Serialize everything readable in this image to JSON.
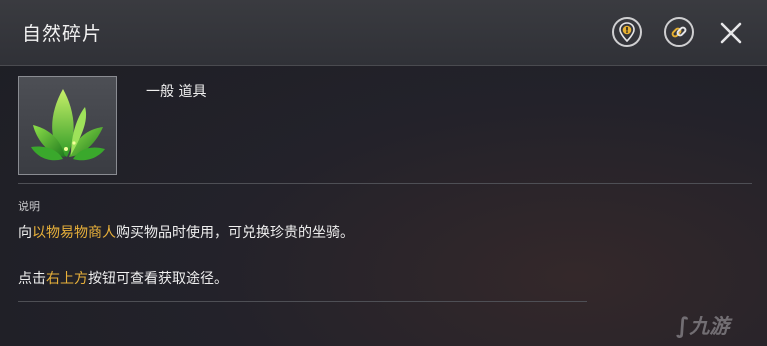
{
  "window": {
    "title": "自然碎片",
    "buttons": {
      "locate_icon": "map-pin-exclamation-icon",
      "link_icon": "chain-link-icon",
      "close_icon": "close-icon"
    }
  },
  "item": {
    "icon": "green-leaf-plant-icon",
    "type_label": "一般 道具"
  },
  "description": {
    "label": "说明",
    "line1": {
      "pre": "向",
      "highlight": "以物易物商人",
      "post": "购买物品时使用，可兑换珍贵的坐骑。"
    },
    "line2": {
      "pre": "点击",
      "highlight": "右上方",
      "post": "按钮可查看获取途径。"
    }
  },
  "watermark": {
    "text": "九游"
  },
  "colors": {
    "highlight": "#e9b13a",
    "header_bg": "#34353b",
    "panel_bg": "#1f1f25"
  }
}
